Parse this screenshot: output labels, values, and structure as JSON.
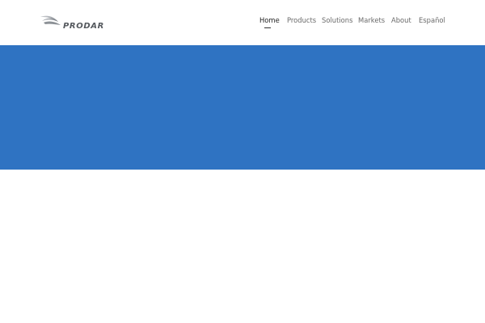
{
  "brand": {
    "logo_text": "PRODAR",
    "logo_icon": "bird-swoosh-icon"
  },
  "nav": {
    "items": [
      {
        "label": "Home",
        "active": true
      },
      {
        "label": "Products",
        "active": false
      },
      {
        "label": "Solutions",
        "active": false
      },
      {
        "label": "Markets",
        "active": false
      },
      {
        "label": "About",
        "active": false
      },
      {
        "label": "Español",
        "active": false
      }
    ]
  },
  "colors": {
    "hero_background": "#2f73c2",
    "page_background": "#ffffff",
    "nav_text": "#6a6a6a",
    "nav_text_active": "#222222"
  }
}
